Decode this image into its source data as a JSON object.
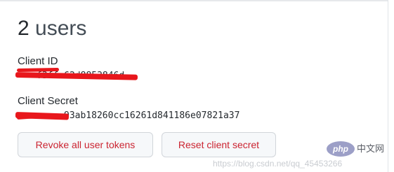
{
  "users": {
    "count": "2",
    "label": "users"
  },
  "client_id": {
    "label": "Client ID",
    "value": "f3ffc62d8853846d"
  },
  "client_secret": {
    "label": "Client Secret",
    "value": "93ab18260cc16261d841186e07821a37"
  },
  "buttons": {
    "revoke_label": "Revoke all user tokens",
    "reset_label": "Reset client secret"
  },
  "watermark": {
    "url": "https://blog.csdn.net/qq_45453266",
    "logo_text": "php",
    "logo_caption": "中文网"
  },
  "colors": {
    "danger_text": "#cb2431",
    "redaction": "#e8171c"
  }
}
